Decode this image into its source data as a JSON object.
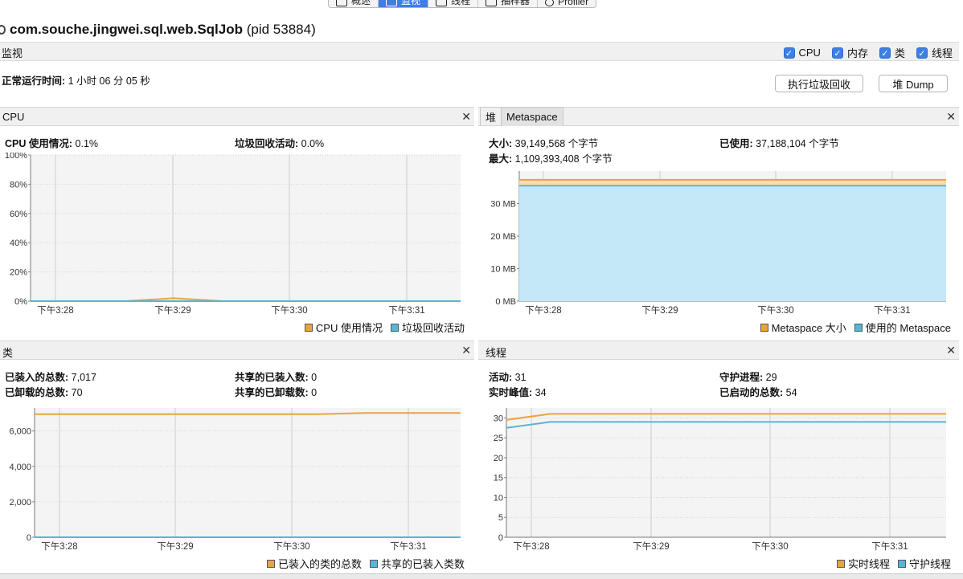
{
  "tabs": [
    {
      "label": "概述",
      "active": false
    },
    {
      "label": "监视",
      "active": true
    },
    {
      "label": "线程",
      "active": false
    },
    {
      "label": "抽样器",
      "active": false
    },
    {
      "label": "Profiler",
      "active": false
    }
  ],
  "app": {
    "process": "com.souche.jingwei.sql.web.SqlJob",
    "pid": "(pid 53884)"
  },
  "monitor": {
    "label": "监视",
    "checks": [
      "CPU",
      "内存",
      "类",
      "线程"
    ],
    "uptime_label": "正常运行时间:",
    "uptime_value": "1 小时 06 分 05 秒",
    "gc_button": "执行垃圾回收",
    "heap_dump_button": "堆 Dump"
  },
  "colors": {
    "orange": "#e8a53c",
    "blue": "#5ab4d6",
    "fill_orange": "#f7ddb0",
    "fill_blue": "#c4e8f8"
  },
  "cpu": {
    "title": "CPU",
    "usage_label": "CPU 使用情况:",
    "usage_value": "0.1%",
    "gc_label": "垃圾回收活动:",
    "gc_value": "0.0%",
    "legend": [
      "CPU 使用情况",
      "垃圾回收活动"
    ]
  },
  "heap": {
    "tab_heap": "堆",
    "tab_meta": "Metaspace",
    "size_label": "大小:",
    "size_value": "39,149,568 个字节",
    "used_label": "已使用:",
    "used_value": "37,188,104 个字节",
    "max_label": "最大:",
    "max_value": "1,109,393,408 个字节",
    "legend": [
      "Metaspace 大小",
      "使用的 Metaspace"
    ]
  },
  "classes": {
    "title": "类",
    "loaded_label": "已装入的总数:",
    "loaded_value": "7,017",
    "unloaded_label": "已卸载的总数:",
    "unloaded_value": "70",
    "shared_loaded_label": "共享的已装入数:",
    "shared_loaded_value": "0",
    "shared_unloaded_label": "共享的已卸载数:",
    "shared_unloaded_value": "0",
    "legend": [
      "已装入的类的总数",
      "共享的已装入类数"
    ]
  },
  "threads": {
    "title": "线程",
    "live_label": "活动:",
    "live_value": "31",
    "daemon_label": "守护进程:",
    "daemon_value": "29",
    "peak_label": "实时峰值:",
    "peak_value": "34",
    "started_label": "已启动的总数:",
    "started_value": "54",
    "legend": [
      "实时线程",
      "守护线程"
    ]
  },
  "chart_data": [
    {
      "type": "line",
      "name": "CPU",
      "x_ticks": [
        "下午3:28",
        "下午3:29",
        "下午3:30",
        "下午3:31"
      ],
      "y_ticks": [
        "0%",
        "20%",
        "40%",
        "60%",
        "80%",
        "100%"
      ],
      "ylim": [
        0,
        100
      ],
      "grid": true,
      "legend_placement": "bottom-right",
      "series": [
        {
          "name": "CPU 使用情况",
          "values": [
            0.1,
            0.1,
            0.1,
            2.0,
            0.1,
            0.1,
            0.1,
            0.1,
            0.1,
            0.1
          ]
        },
        {
          "name": "垃圾回收活动",
          "values": [
            0,
            0,
            0,
            0,
            0,
            0,
            0,
            0,
            0,
            0
          ]
        }
      ]
    },
    {
      "type": "area",
      "name": "Metaspace",
      "x_ticks": [
        "下午3:28",
        "下午3:29",
        "下午3:30",
        "下午3:31"
      ],
      "y_ticks": [
        "0 MB",
        "10 MB",
        "20 MB",
        "30 MB"
      ],
      "ylim": [
        0,
        40
      ],
      "grid": true,
      "legend_placement": "bottom-right",
      "series": [
        {
          "name": "Metaspace 大小",
          "values": [
            37.3,
            37.3
          ]
        },
        {
          "name": "使用的 Metaspace",
          "values": [
            35.5,
            35.5
          ]
        }
      ]
    },
    {
      "type": "line",
      "name": "类",
      "x_ticks": [
        "下午3:28",
        "下午3:29",
        "下午3:30",
        "下午3:31"
      ],
      "y_ticks": [
        "0",
        "2,000",
        "4,000",
        "6,000"
      ],
      "ylim": [
        0,
        7300
      ],
      "grid": true,
      "legend_placement": "bottom-right",
      "series": [
        {
          "name": "已装入的类的总数",
          "values": [
            6947,
            6947,
            6947,
            6947,
            6947,
            6947,
            6947,
            7017,
            7017,
            7017
          ]
        },
        {
          "name": "共享的已装入类数",
          "values": [
            0,
            0,
            0,
            0,
            0,
            0,
            0,
            0,
            0,
            0
          ]
        }
      ]
    },
    {
      "type": "line",
      "name": "线程",
      "x_ticks": [
        "下午3:28",
        "下午3:29",
        "下午3:30",
        "下午3:31"
      ],
      "y_ticks": [
        "0",
        "5",
        "10",
        "15",
        "20",
        "25",
        "30"
      ],
      "ylim": [
        0,
        32.5
      ],
      "grid": true,
      "legend_placement": "bottom-right",
      "series": [
        {
          "name": "实时线程",
          "values": [
            29.5,
            31,
            31,
            31,
            31,
            31,
            31,
            31,
            31,
            31,
            31
          ]
        },
        {
          "name": "守护线程",
          "values": [
            27.5,
            29,
            29,
            29,
            29,
            29,
            29,
            29,
            29,
            29,
            29
          ]
        }
      ]
    }
  ]
}
